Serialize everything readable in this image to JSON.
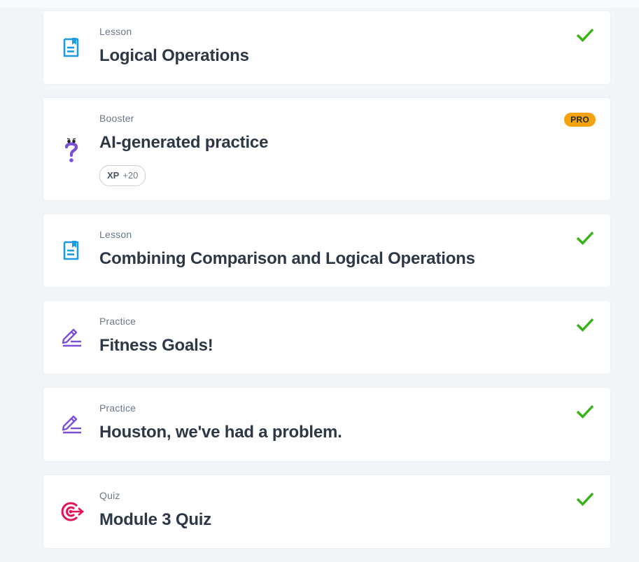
{
  "colors": {
    "lesson_icon": "#1b9ce3",
    "booster_icon": "#7b4fd6",
    "practice_icon": "#7b4fd6",
    "quiz_icon": "#e1135c",
    "check": "#35b214",
    "pro_badge": "#f5a20f"
  },
  "items": [
    {
      "type": "Lesson",
      "title": "Logical Operations",
      "icon": "document-icon",
      "completed": true
    },
    {
      "type": "Booster",
      "title": "AI-generated practice",
      "icon": "question-mark-icon",
      "badge": "PRO",
      "xp_label": "XP",
      "xp_value": "+20",
      "completed": false
    },
    {
      "type": "Lesson",
      "title": "Combining Comparison and Logical Operations",
      "icon": "document-icon",
      "completed": true
    },
    {
      "type": "Practice",
      "title": "Fitness Goals!",
      "icon": "pencil-icon",
      "completed": true
    },
    {
      "type": "Practice",
      "title": "Houston, we've had a problem.",
      "icon": "pencil-icon",
      "completed": true
    },
    {
      "type": "Quiz",
      "title": "Module 3 Quiz",
      "icon": "target-icon",
      "completed": true
    }
  ]
}
